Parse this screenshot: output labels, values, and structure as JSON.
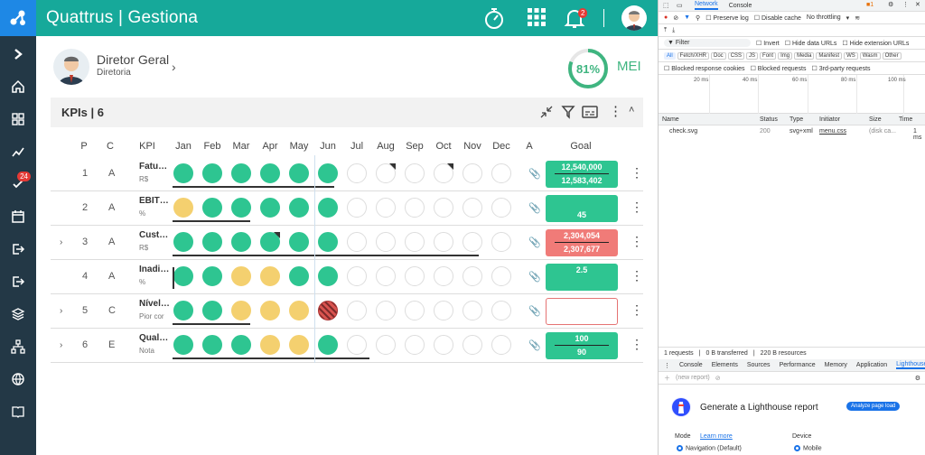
{
  "app": {
    "title": "Quattrus | Gestiona",
    "notif_count": "2",
    "sidebar_badge": "24"
  },
  "user": {
    "name": "Diretor Geral",
    "role": "Diretoria",
    "score": "81%",
    "score_value": 81,
    "score_label": "MEI"
  },
  "kpi": {
    "title": "KPIs | 6"
  },
  "columns": [
    "P",
    "C",
    "KPI",
    "Jan",
    "Feb",
    "Mar",
    "Apr",
    "May",
    "Jun",
    "Jul",
    "Aug",
    "Sep",
    "Oct",
    "Nov",
    "Dec",
    "A",
    "Goal"
  ],
  "rows": [
    {
      "p": "1",
      "c": "A",
      "name": "Fatur…",
      "unit": "R$",
      "expand": "",
      "circles": [
        "g",
        "g",
        "g",
        "g",
        "g",
        "g",
        "e",
        "ef",
        "e",
        "ef",
        "e",
        "e"
      ],
      "goal_type": "g",
      "goal_top": "12,540,000",
      "goal_bottom": "12,583,402",
      "attach": "📎"
    },
    {
      "p": "2",
      "c": "A",
      "name": "EBITDA",
      "unit": "%",
      "expand": "",
      "circles": [
        "y",
        "g",
        "g",
        "g",
        "g",
        "g",
        "e",
        "e",
        "e",
        "e",
        "e",
        "e"
      ],
      "goal_type": "g",
      "goal_top": "",
      "goal_bottom": "45",
      "attach": "📎"
    },
    {
      "p": "3",
      "c": "A",
      "name": "Custo…",
      "unit": "R$",
      "expand": "›",
      "circles": [
        "g",
        "g",
        "g",
        "gf",
        "g",
        "g",
        "e",
        "e",
        "e",
        "e",
        "e",
        "e"
      ],
      "goal_type": "r",
      "goal_top": "2,304,054",
      "goal_bottom": "2,307,677",
      "attach": "📎"
    },
    {
      "p": "4",
      "c": "A",
      "name": "Inadi…",
      "unit": "%",
      "expand": "",
      "circles": [
        "g",
        "g",
        "y",
        "y",
        "g",
        "g",
        "e",
        "e",
        "e",
        "e",
        "e",
        "e"
      ],
      "goal_type": "g",
      "goal_top": "2.5",
      "goal_bottom": "",
      "attach": "📎"
    },
    {
      "p": "5",
      "c": "C",
      "name": "Nível …",
      "unit": "Pior cor",
      "expand": "›",
      "circles": [
        "g",
        "g",
        "y",
        "y",
        "y",
        "h",
        "e",
        "e",
        "e",
        "e",
        "e",
        "e"
      ],
      "goal_type": "w",
      "goal_top": "",
      "goal_bottom": "",
      "attach": "📎"
    },
    {
      "p": "6",
      "c": "E",
      "name": "Quali…",
      "unit": "Nota",
      "expand": "›",
      "circles": [
        "g",
        "g",
        "g",
        "y",
        "y",
        "g",
        "e",
        "e",
        "e",
        "e",
        "e",
        "e"
      ],
      "goal_type": "g",
      "goal_top": "100",
      "goal_bottom": "90",
      "attach": "📎"
    }
  ],
  "devtools": {
    "top_tabs": [
      "Network",
      "Console"
    ],
    "preserve_log": "Preserve log",
    "disable_cache": "Disable cache",
    "throttling": "No throttling",
    "filter_placeholder": "Filter",
    "invert": "Invert",
    "hide_data_urls": "Hide data URLs",
    "hide_ext_urls": "Hide extension URLs",
    "type_filters": [
      "All",
      "Fetch/XHR",
      "Doc",
      "CSS",
      "JS",
      "Font",
      "Img",
      "Media",
      "Manifest",
      "WS",
      "Wasm",
      "Other"
    ],
    "blocked_cookies": "Blocked response cookies",
    "blocked_requests": "Blocked requests",
    "third_party": "3rd-party requests",
    "timeline_ticks": [
      "20 ms",
      "40 ms",
      "60 ms",
      "80 ms",
      "100 ms"
    ],
    "net_columns": [
      "Name",
      "Status",
      "Type",
      "Initiator",
      "Size",
      "Time"
    ],
    "net_row": {
      "name": "check.svg",
      "status": "200",
      "type": "svg+xml",
      "initiator": "menu.css",
      "size": "(disk ca...",
      "time": "1 ms"
    },
    "status_bar": [
      "1 requests",
      "0 B transferred",
      "220 B resources"
    ],
    "drawer_tabs": [
      "Console",
      "Elements",
      "Sources",
      "Performance",
      "Memory",
      "Application",
      "Lighthouse"
    ],
    "new_report": "(new report)",
    "lighthouse_title": "Generate a Lighthouse report",
    "analyze_btn": "Analyze page load",
    "mode_label": "Mode",
    "learn_more": "Learn more",
    "device_label": "Device",
    "mode_option": "Navigation (Default)",
    "device_option": "Mobile"
  }
}
